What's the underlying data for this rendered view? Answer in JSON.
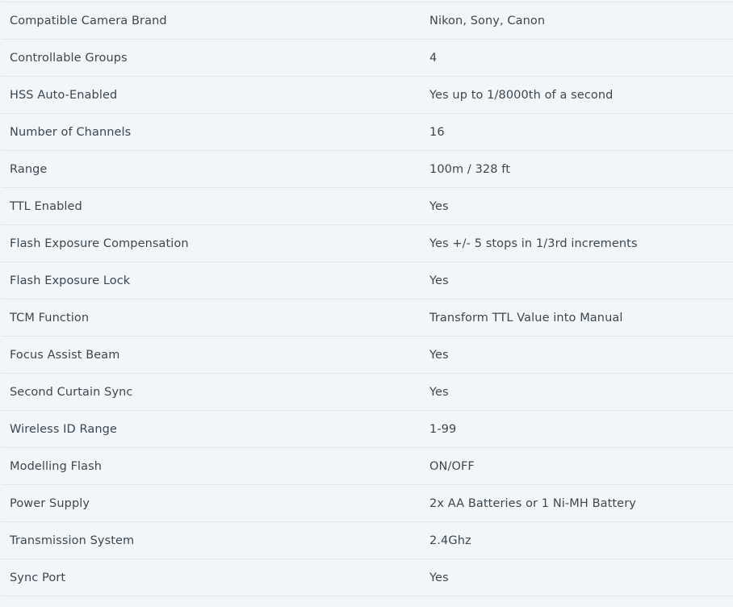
{
  "specs": [
    {
      "label": "Compatible Camera Brand",
      "value": "Nikon, Sony, Canon"
    },
    {
      "label": "Controllable Groups",
      "value": "4"
    },
    {
      "label": "HSS Auto-Enabled",
      "value": "Yes up to 1/8000th of a second"
    },
    {
      "label": "Number of Channels",
      "value": "16"
    },
    {
      "label": "Range",
      "value": "100m / 328 ft"
    },
    {
      "label": "TTL Enabled",
      "value": "Yes"
    },
    {
      "label": "Flash Exposure Compensation",
      "value": "Yes +/- 5 stops in 1/3rd increments"
    },
    {
      "label": "Flash Exposure Lock",
      "value": "Yes"
    },
    {
      "label": "TCM Function",
      "value": "Transform TTL Value into Manual"
    },
    {
      "label": "Focus Assist Beam",
      "value": "Yes"
    },
    {
      "label": "Second Curtain Sync",
      "value": "Yes"
    },
    {
      "label": "Wireless ID Range",
      "value": "1-99"
    },
    {
      "label": "Modelling Flash",
      "value": "ON/OFF"
    },
    {
      "label": "Power Supply",
      "value": "2x AA Batteries or 1 Ni-MH Battery"
    },
    {
      "label": "Transmission System",
      "value": "2.4Ghz"
    },
    {
      "label": "Sync Port",
      "value": "Yes"
    }
  ]
}
